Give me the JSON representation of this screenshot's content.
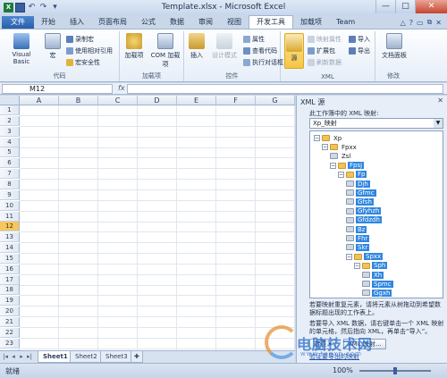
{
  "window": {
    "title": "Template.xlsx - Microsoft Excel",
    "controls": [
      "—",
      "□",
      "✕"
    ]
  },
  "qat": {
    "logo": "X"
  },
  "ribbon_tabs": [
    {
      "label": "文件"
    },
    {
      "label": "开始"
    },
    {
      "label": "插入"
    },
    {
      "label": "页面布局"
    },
    {
      "label": "公式"
    },
    {
      "label": "数据"
    },
    {
      "label": "审阅"
    },
    {
      "label": "视图"
    },
    {
      "label": "开发工具"
    },
    {
      "label": "加载项"
    },
    {
      "label": "Team"
    }
  ],
  "ribbon": {
    "code": {
      "label": "代码",
      "visual_basic": "Visual Basic",
      "macro": "宏",
      "record_macro": "录制宏",
      "relative_ref": "使用相对引用",
      "macro_security": "宏安全性"
    },
    "addins": {
      "label": "加载项",
      "addins_btn": "加载项",
      "com_addins": "COM 加载项"
    },
    "controls": {
      "label": "控件",
      "insert": "插入",
      "design_mode": "设计模式",
      "properties": "属性",
      "view_code": "查看代码",
      "run_dialog": "执行对话框"
    },
    "xml": {
      "label": "XML",
      "source": "源",
      "map_properties": "映射属性",
      "expansion_packs": "扩展包",
      "refresh_data": "刷新数据",
      "import": "导入",
      "export": "导出"
    },
    "modify": {
      "label": "修改",
      "document_panel": "文档面板"
    }
  },
  "formula_bar": {
    "name_box": "M12",
    "fx": "fx"
  },
  "grid": {
    "columns": [
      "A",
      "B",
      "C",
      "D",
      "E",
      "F",
      "G"
    ],
    "rows": [
      "1",
      "2",
      "3",
      "4",
      "5",
      "6",
      "7",
      "8",
      "9",
      "10",
      "11",
      "12",
      "13",
      "14",
      "15",
      "16",
      "17",
      "18",
      "19",
      "20",
      "21",
      "22",
      "23",
      "24"
    ],
    "selected_row": "12"
  },
  "sheets": [
    {
      "label": "Sheet1"
    },
    {
      "label": "Sheet2"
    },
    {
      "label": "Sheet3"
    }
  ],
  "status": {
    "ready": "就绪",
    "zoom": "100%",
    "zoom_level": 1.0
  },
  "xml_pane": {
    "title": "XML 源",
    "close": "✕",
    "subtitle": "此工作簿中的 XML 映射:",
    "selected_map": "Xp_映射",
    "tree": [
      {
        "label": "Xp",
        "depth": 0,
        "type": "folder",
        "hl": false
      },
      {
        "label": "Fpxx",
        "depth": 1,
        "type": "folder",
        "hl": false
      },
      {
        "label": "Zsl",
        "depth": 2,
        "type": "elem",
        "hl": false
      },
      {
        "label": "Fpsj",
        "depth": 2,
        "type": "folder",
        "hl": true
      },
      {
        "label": "Fp",
        "depth": 3,
        "type": "folder",
        "hl": true
      },
      {
        "label": "Djh",
        "depth": 4,
        "type": "elem",
        "hl": true
      },
      {
        "label": "Gfmc",
        "depth": 4,
        "type": "elem",
        "hl": true
      },
      {
        "label": "Gfsh",
        "depth": 4,
        "type": "elem",
        "hl": true
      },
      {
        "label": "Gfyhzh",
        "depth": 4,
        "type": "elem",
        "hl": true
      },
      {
        "label": "Gfdzdh",
        "depth": 4,
        "type": "elem",
        "hl": true
      },
      {
        "label": "Bz",
        "depth": 4,
        "type": "elem",
        "hl": true
      },
      {
        "label": "Fhr",
        "depth": 4,
        "type": "elem",
        "hl": true
      },
      {
        "label": "Skr",
        "depth": 4,
        "type": "elem",
        "hl": true
      },
      {
        "label": "Spxx",
        "depth": 4,
        "type": "folder",
        "hl": true
      },
      {
        "label": "Sph",
        "depth": 5,
        "type": "folder",
        "hl": true
      },
      {
        "label": "Xh",
        "depth": 6,
        "type": "elem",
        "hl": true
      },
      {
        "label": "Spmc",
        "depth": 6,
        "type": "elem",
        "hl": true
      },
      {
        "label": "Ggxh",
        "depth": 6,
        "type": "elem",
        "hl": true
      }
    ],
    "note1": "若要映射重复元素，请将元素从树拖动到希望数据标题出现的工作表上。",
    "note2": "若要导入 XML 数据，请右键单击一个 XML 映射的单元格，然后指向 XML，再单击“导入”。",
    "options_btn": "选项",
    "map_btn": "XML 映射...",
    "link": "验证要导出的映射"
  }
}
